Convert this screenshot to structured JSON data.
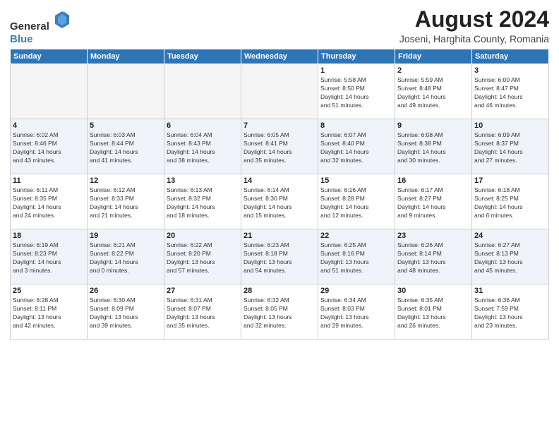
{
  "header": {
    "logo_general": "General",
    "logo_blue": "Blue",
    "month_title": "August 2024",
    "location": "Joseni, Harghita County, Romania"
  },
  "weekdays": [
    "Sunday",
    "Monday",
    "Tuesday",
    "Wednesday",
    "Thursday",
    "Friday",
    "Saturday"
  ],
  "weeks": [
    [
      {
        "day": "",
        "info": ""
      },
      {
        "day": "",
        "info": ""
      },
      {
        "day": "",
        "info": ""
      },
      {
        "day": "",
        "info": ""
      },
      {
        "day": "1",
        "info": "Sunrise: 5:58 AM\nSunset: 8:50 PM\nDaylight: 14 hours\nand 51 minutes."
      },
      {
        "day": "2",
        "info": "Sunrise: 5:59 AM\nSunset: 8:48 PM\nDaylight: 14 hours\nand 49 minutes."
      },
      {
        "day": "3",
        "info": "Sunrise: 6:00 AM\nSunset: 8:47 PM\nDaylight: 14 hours\nand 46 minutes."
      }
    ],
    [
      {
        "day": "4",
        "info": "Sunrise: 6:02 AM\nSunset: 8:46 PM\nDaylight: 14 hours\nand 43 minutes."
      },
      {
        "day": "5",
        "info": "Sunrise: 6:03 AM\nSunset: 8:44 PM\nDaylight: 14 hours\nand 41 minutes."
      },
      {
        "day": "6",
        "info": "Sunrise: 6:04 AM\nSunset: 8:43 PM\nDaylight: 14 hours\nand 38 minutes."
      },
      {
        "day": "7",
        "info": "Sunrise: 6:05 AM\nSunset: 8:41 PM\nDaylight: 14 hours\nand 35 minutes."
      },
      {
        "day": "8",
        "info": "Sunrise: 6:07 AM\nSunset: 8:40 PM\nDaylight: 14 hours\nand 32 minutes."
      },
      {
        "day": "9",
        "info": "Sunrise: 6:08 AM\nSunset: 8:38 PM\nDaylight: 14 hours\nand 30 minutes."
      },
      {
        "day": "10",
        "info": "Sunrise: 6:09 AM\nSunset: 8:37 PM\nDaylight: 14 hours\nand 27 minutes."
      }
    ],
    [
      {
        "day": "11",
        "info": "Sunrise: 6:11 AM\nSunset: 8:35 PM\nDaylight: 14 hours\nand 24 minutes."
      },
      {
        "day": "12",
        "info": "Sunrise: 6:12 AM\nSunset: 8:33 PM\nDaylight: 14 hours\nand 21 minutes."
      },
      {
        "day": "13",
        "info": "Sunrise: 6:13 AM\nSunset: 8:32 PM\nDaylight: 14 hours\nand 18 minutes."
      },
      {
        "day": "14",
        "info": "Sunrise: 6:14 AM\nSunset: 8:30 PM\nDaylight: 14 hours\nand 15 minutes."
      },
      {
        "day": "15",
        "info": "Sunrise: 6:16 AM\nSunset: 8:28 PM\nDaylight: 14 hours\nand 12 minutes."
      },
      {
        "day": "16",
        "info": "Sunrise: 6:17 AM\nSunset: 8:27 PM\nDaylight: 14 hours\nand 9 minutes."
      },
      {
        "day": "17",
        "info": "Sunrise: 6:18 AM\nSunset: 8:25 PM\nDaylight: 14 hours\nand 6 minutes."
      }
    ],
    [
      {
        "day": "18",
        "info": "Sunrise: 6:19 AM\nSunset: 8:23 PM\nDaylight: 14 hours\nand 3 minutes."
      },
      {
        "day": "19",
        "info": "Sunrise: 6:21 AM\nSunset: 8:22 PM\nDaylight: 14 hours\nand 0 minutes."
      },
      {
        "day": "20",
        "info": "Sunrise: 6:22 AM\nSunset: 8:20 PM\nDaylight: 13 hours\nand 57 minutes."
      },
      {
        "day": "21",
        "info": "Sunrise: 6:23 AM\nSunset: 8:18 PM\nDaylight: 13 hours\nand 54 minutes."
      },
      {
        "day": "22",
        "info": "Sunrise: 6:25 AM\nSunset: 8:16 PM\nDaylight: 13 hours\nand 51 minutes."
      },
      {
        "day": "23",
        "info": "Sunrise: 6:26 AM\nSunset: 8:14 PM\nDaylight: 13 hours\nand 48 minutes."
      },
      {
        "day": "24",
        "info": "Sunrise: 6:27 AM\nSunset: 8:13 PM\nDaylight: 13 hours\nand 45 minutes."
      }
    ],
    [
      {
        "day": "25",
        "info": "Sunrise: 6:28 AM\nSunset: 8:11 PM\nDaylight: 13 hours\nand 42 minutes."
      },
      {
        "day": "26",
        "info": "Sunrise: 6:30 AM\nSunset: 8:09 PM\nDaylight: 13 hours\nand 39 minutes."
      },
      {
        "day": "27",
        "info": "Sunrise: 6:31 AM\nSunset: 8:07 PM\nDaylight: 13 hours\nand 35 minutes."
      },
      {
        "day": "28",
        "info": "Sunrise: 6:32 AM\nSunset: 8:05 PM\nDaylight: 13 hours\nand 32 minutes."
      },
      {
        "day": "29",
        "info": "Sunrise: 6:34 AM\nSunset: 8:03 PM\nDaylight: 13 hours\nand 29 minutes."
      },
      {
        "day": "30",
        "info": "Sunrise: 6:35 AM\nSunset: 8:01 PM\nDaylight: 13 hours\nand 26 minutes."
      },
      {
        "day": "31",
        "info": "Sunrise: 6:36 AM\nSunset: 7:59 PM\nDaylight: 13 hours\nand 23 minutes."
      }
    ]
  ]
}
